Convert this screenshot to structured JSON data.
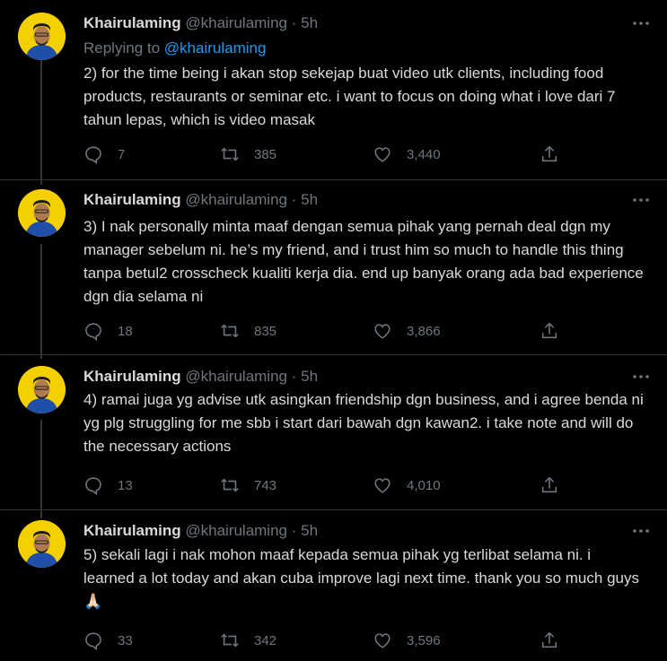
{
  "tweets": [
    {
      "name": "Khairulaming",
      "handle": "@khairulaming",
      "dot": "·",
      "time": "5h",
      "reply_prefix": "Replying to ",
      "reply_to": "@khairulaming",
      "text": "2) for the time being i akan stop sekejap buat video utk clients, including food products, restaurants or seminar etc. i want to focus on doing what i love dari 7 tahun lepas, which is video masak",
      "replies": "7",
      "retweets": "385",
      "likes": "3,440"
    },
    {
      "name": "Khairulaming",
      "handle": "@khairulaming",
      "dot": "·",
      "time": "5h",
      "text": "3) I nak personally minta maaf dengan semua pihak yang pernah deal dgn my manager sebelum ni. he’s my friend, and i trust him so much to handle this thing tanpa betul2 crosscheck kualiti kerja dia. end up banyak orang ada bad experience dgn dia selama ni",
      "replies": "18",
      "retweets": "835",
      "likes": "3,866"
    },
    {
      "name": "Khairulaming",
      "handle": "@khairulaming",
      "dot": "·",
      "time": "5h",
      "text": "4) ramai juga yg advise utk asingkan friendship dgn business, and i agree benda ni yg plg struggling for me sbb i start dari bawah dgn kawan2. i take note and will do the necessary actions",
      "replies": "13",
      "retweets": "743",
      "likes": "4,010"
    },
    {
      "name": "Khairulaming",
      "handle": "@khairulaming",
      "dot": "·",
      "time": "5h",
      "text": "5) sekali lagi i nak mohon maaf kepada semua pihak yg terlibat selama ni. i learned a lot today and akan cuba improve lagi next time. thank you so much guys 🙏🏻",
      "replies": "33",
      "retweets": "342",
      "likes": "3,596"
    }
  ],
  "colors": {
    "background": "#000000",
    "text": "#d9d9d9",
    "muted": "#6e767d",
    "mention": "#1d9bf0",
    "avatar_bg": "#f5d000"
  }
}
